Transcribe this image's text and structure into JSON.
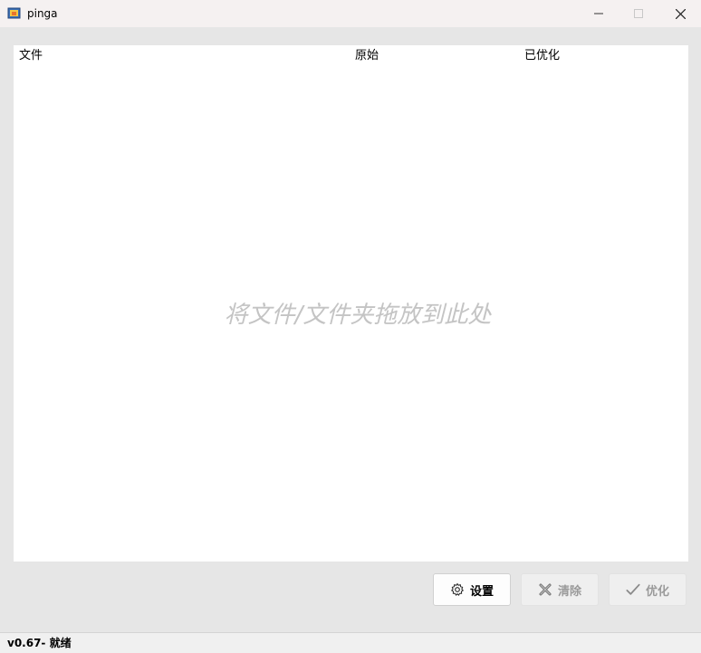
{
  "window": {
    "title": "pinga"
  },
  "filelist": {
    "columns": [
      "文件",
      "原始",
      "已优化"
    ],
    "drop_hint": "将文件/文件夹拖放到此处"
  },
  "buttons": {
    "settings": "设置",
    "clear": "清除",
    "optimize": "优化"
  },
  "status": {
    "text": "v0.67- 就绪"
  }
}
